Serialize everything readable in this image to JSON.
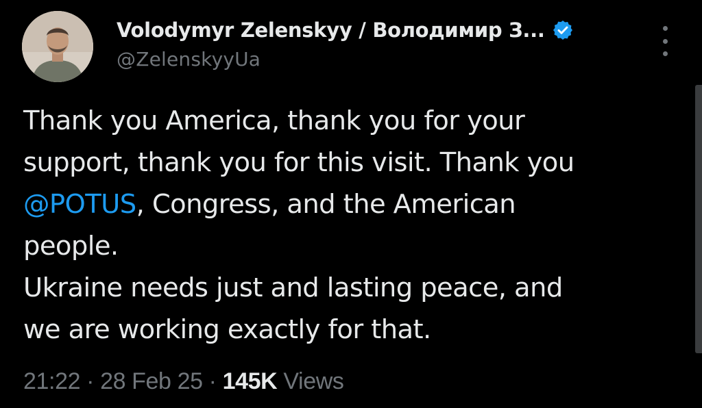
{
  "author": {
    "display_name": "Volodymyr Zelenskyy / Володимир З...",
    "handle": "@ZelenskyyUa",
    "verified_icon": "verified-badge-icon",
    "avatar": "profile-photo"
  },
  "menu": {
    "icon": "more-vertical-icon"
  },
  "tweet": {
    "lines": [
      {
        "text": "Thank you America, thank you for your"
      },
      {
        "text": "support, thank you for this visit. Thank you"
      },
      {
        "mention": "@POTUS",
        "rest": ", Congress, and the American"
      },
      {
        "text": "people."
      },
      {
        "text": "Ukraine needs just and lasting peace, and"
      },
      {
        "text": "we are working exactly for that."
      }
    ]
  },
  "meta": {
    "time": "21:22",
    "separator": " · ",
    "date": "28 Feb 25",
    "views_count": "145K",
    "views_label": " Views"
  },
  "colors": {
    "background": "#000000",
    "text": "#e7e9ea",
    "secondary": "#71767b",
    "accent": "#1d9bf0"
  }
}
